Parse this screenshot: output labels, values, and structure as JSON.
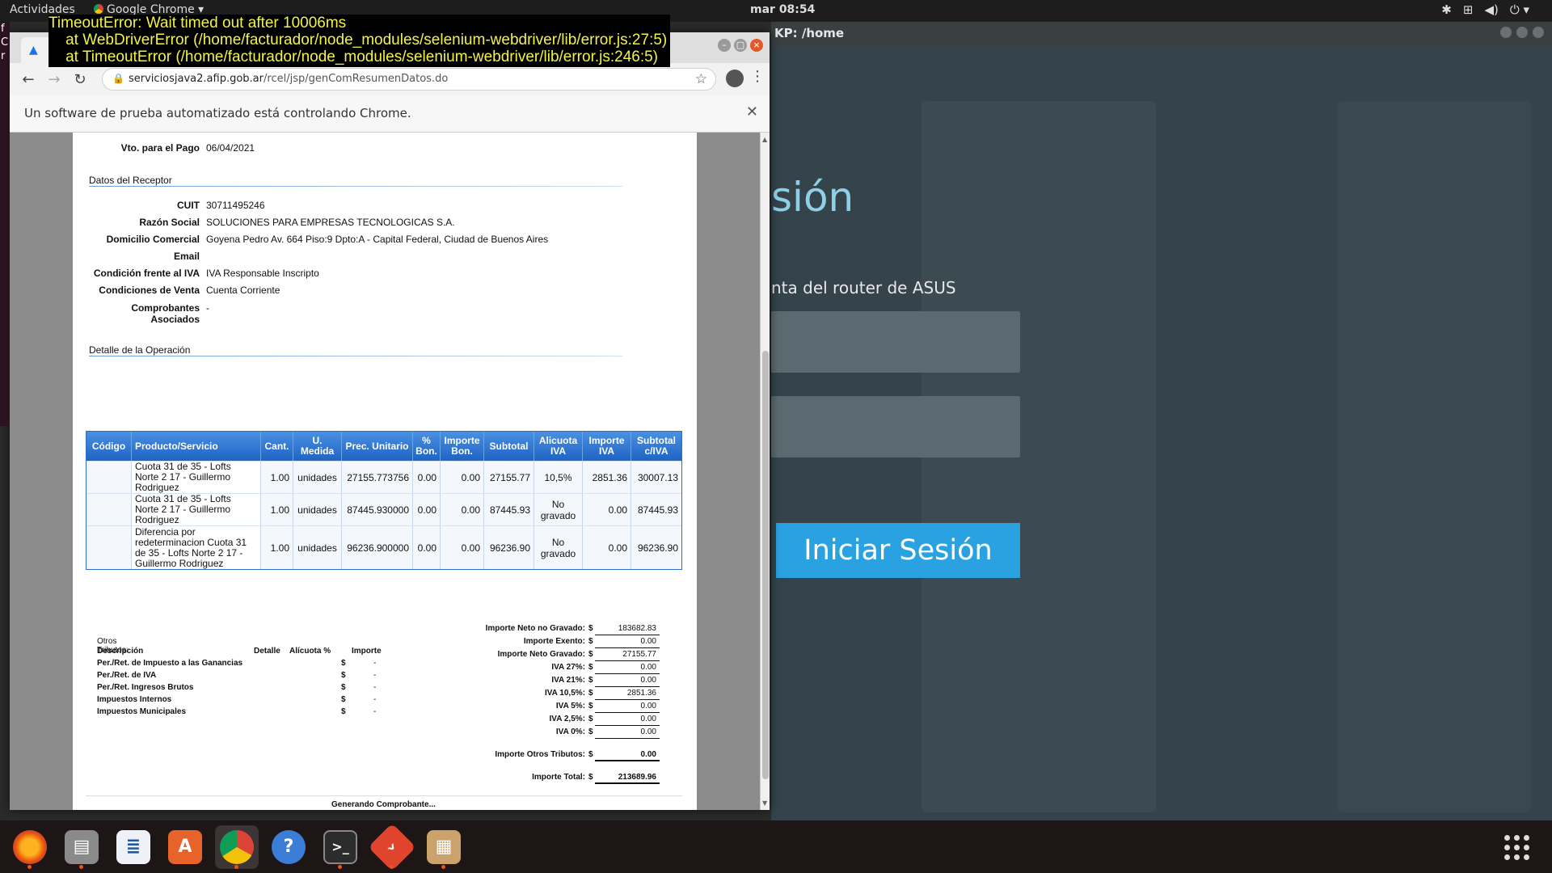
{
  "topbar": {
    "activities": "Actividades",
    "app_menu": "Google Chrome",
    "clock": "mar 08:54"
  },
  "error": {
    "lines": [
      "TimeoutError: Wait timed out after 10006ms",
      "    at WebDriverError (/home/facturador/node_modules/selenium-webdriver/lib/error.js:27:5)",
      "    at TimeoutError (/home/facturador/node_modules/selenium-webdriver/lib/error.js:246:5)"
    ]
  },
  "bg_window": {
    "title": "KP: /home",
    "heading": "sión",
    "subtitle": "nta del router de ASUS",
    "login_button": "Iniciar Sesión"
  },
  "chrome": {
    "url_host": "serviciosjava2.afip.gob.ar",
    "url_path": "/rcel/jsp/genComResumenDatos.do",
    "infobar": "Un software de prueba automatizado está controlando Chrome."
  },
  "page": {
    "vto": {
      "label": "Vto. para el Pago",
      "value": "06/04/2021"
    },
    "receptor_title": "Datos del Receptor",
    "receptor": [
      {
        "label": "CUIT",
        "value": "30711495246"
      },
      {
        "label": "Razón Social",
        "value": "SOLUCIONES PARA EMPRESAS TECNOLOGICAS S.A."
      },
      {
        "label": "Domicilio Comercial",
        "value": "Goyena Pedro Av. 664 Piso:9 Dpto:A - Capital Federal, Ciudad de Buenos Aires"
      },
      {
        "label": "Email",
        "value": ""
      },
      {
        "label": "Condición frente al IVA",
        "value": "IVA Responsable Inscripto"
      },
      {
        "label": "Condiciones de Venta",
        "value": "Cuenta Corriente"
      },
      {
        "label": "Comprobantes Asociados",
        "value": "-"
      }
    ],
    "detalle_title": "Detalle de la Operación",
    "table": {
      "headers": [
        "Código",
        "Producto/Servicio",
        "Cant.",
        "U. Medida",
        "Prec. Unitario",
        "% Bon.",
        "Importe Bon.",
        "Subtotal",
        "Alicuota IVA",
        "Importe IVA",
        "Subtotal c/IVA"
      ],
      "rows": [
        {
          "codigo": "",
          "producto": "Cuota 31 de 35 - Lofts Norte 2 17 - Guillermo Rodriguez",
          "cant": "1.00",
          "um": "unidades",
          "pu": "27155.773756",
          "bon": "0.00",
          "ibon": "0.00",
          "subtotal": "27155.77",
          "alicuota": "10,5%",
          "iiva": "2851.36",
          "siva": "30007.13"
        },
        {
          "codigo": "",
          "producto": "Cuota 31 de 35 - Lofts Norte 2 17 - Guillermo Rodriguez",
          "cant": "1.00",
          "um": "unidades",
          "pu": "87445.930000",
          "bon": "0.00",
          "ibon": "0.00",
          "subtotal": "87445.93",
          "alicuota": "No gravado",
          "iiva": "0.00",
          "siva": "87445.93"
        },
        {
          "codigo": "",
          "producto": "Diferencia por redeterminacion Cuota 31 de 35 - Lofts Norte 2 17 - Guillermo Rodriguez",
          "cant": "1.00",
          "um": "unidades",
          "pu": "96236.900000",
          "bon": "0.00",
          "ibon": "0.00",
          "subtotal": "96236.90",
          "alicuota": "No gravado",
          "iiva": "0.00",
          "siva": "96236.90"
        }
      ]
    },
    "otros": {
      "title": "Otros Tributos:",
      "headers": [
        "Descripción",
        "Detalle",
        "Alícuota %",
        "Importe"
      ],
      "rows": [
        {
          "desc": "Per./Ret. de Impuesto a las Ganancias",
          "cur": "$",
          "imp": "-"
        },
        {
          "desc": "Per./Ret. de IVA",
          "cur": "$",
          "imp": "-"
        },
        {
          "desc": "Per./Ret. Ingresos Brutos",
          "cur": "$",
          "imp": "-"
        },
        {
          "desc": "Impuestos Internos",
          "cur": "$",
          "imp": "-"
        },
        {
          "desc": "Impuestos Municipales",
          "cur": "$",
          "imp": "-"
        }
      ]
    },
    "totals": [
      {
        "label": "Importe Neto no Gravado:",
        "cur": "$",
        "value": "183682.83"
      },
      {
        "label": "Importe Exento:",
        "cur": "$",
        "value": "0.00"
      },
      {
        "label": "Importe Neto Gravado:",
        "cur": "$",
        "value": "27155.77"
      },
      {
        "label": "IVA 27%:",
        "cur": "$",
        "value": "0.00"
      },
      {
        "label": "IVA 21%:",
        "cur": "$",
        "value": "0.00"
      },
      {
        "label": "IVA 10,5%:",
        "cur": "$",
        "value": "2851.36"
      },
      {
        "label": "IVA 5%:",
        "cur": "$",
        "value": "0.00"
      },
      {
        "label": "IVA 2,5%:",
        "cur": "$",
        "value": "0.00"
      },
      {
        "label": "IVA 0%:",
        "cur": "$",
        "value": "0.00"
      }
    ],
    "otros_total": {
      "label": "Importe Otros Tributos:",
      "cur": "$",
      "value": "0.00"
    },
    "total": {
      "label": "Importe Total:",
      "cur": "$",
      "value": "213689.96"
    },
    "generando": "Generando Comprobante..."
  },
  "dock": [
    "firefox-icon",
    "files-icon",
    "writer-icon",
    "software-icon",
    "chrome-icon",
    "help-icon",
    "terminal-icon",
    "git-icon",
    "archive-icon"
  ]
}
